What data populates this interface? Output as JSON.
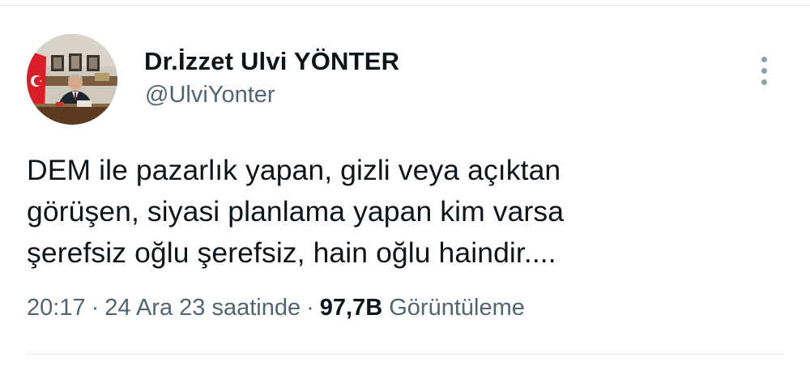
{
  "author": {
    "display_name": "Dr.İzzet Ulvi YÖNTER",
    "handle": "@UlviYonter"
  },
  "tweet": {
    "text_lines": [
      "DEM ile pazarlık yapan, gizli veya açıktan",
      "görüşen, siyasi planlama yapan kim varsa",
      "şerefsiz oğlu şerefsiz, hain oğlu haindir...."
    ],
    "time": "20:17",
    "date": "24 Ara 23 saatinde",
    "separator": "·",
    "views_count": "97,7B",
    "views_label": "Görüntüleme"
  },
  "icons": {
    "more": "more-vertical-icon"
  },
  "colors": {
    "text_primary": "#0f1419",
    "text_secondary": "#536471",
    "divider": "#e1e6ea",
    "more_icon": "#8fa0ad"
  }
}
